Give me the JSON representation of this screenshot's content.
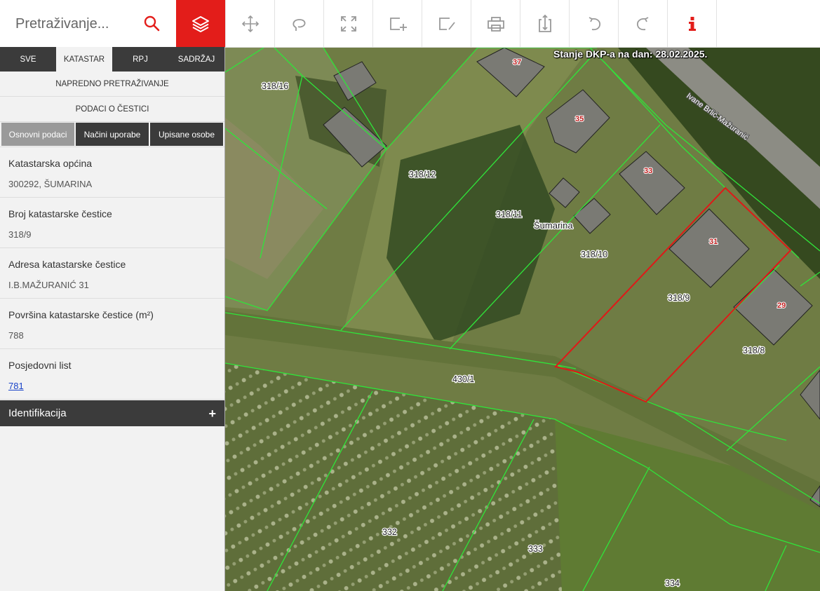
{
  "search": {
    "placeholder": "Pretraživanje..."
  },
  "toolbar": {
    "tools": [
      {
        "name": "layers",
        "icon": "layers-icon"
      },
      {
        "name": "pan",
        "icon": "move-icon"
      },
      {
        "name": "lasso",
        "icon": "lasso-icon"
      },
      {
        "name": "fullscreen",
        "icon": "fullscreen-icon"
      },
      {
        "name": "add-area",
        "icon": "add-area-icon"
      },
      {
        "name": "edit-area",
        "icon": "edit-area-icon"
      },
      {
        "name": "print",
        "icon": "print-icon"
      },
      {
        "name": "export",
        "icon": "export-icon"
      },
      {
        "name": "undo",
        "icon": "undo-icon"
      },
      {
        "name": "redo",
        "icon": "redo-icon"
      },
      {
        "name": "info",
        "icon": "info-icon"
      }
    ],
    "accent_color": "#e31d1a"
  },
  "panel": {
    "top_tabs": [
      "SVE",
      "KATASTAR",
      "RPJ",
      "SADRŽAJ"
    ],
    "advanced_search": "NAPREDNO PRETRAŽIVANJE",
    "parcel_info": "PODACI O ČESTICI",
    "sub_tabs": [
      "Osnovni podaci",
      "Načini uporabe",
      "Upisane osobe"
    ],
    "fields": [
      {
        "label": "Katastarska općina",
        "value": "300292, ŠUMARINA"
      },
      {
        "label": "Broj katastarske čestice",
        "value": "318/9"
      },
      {
        "label": "Adresa katastarske čestice",
        "value": "I.B.MAŽURANIĆ 31"
      },
      {
        "label": "Površina katastarske čestice (m²)",
        "value": "788"
      },
      {
        "label": "Posjedovni list",
        "value": "781"
      }
    ],
    "identification": "Identifikacija"
  },
  "map": {
    "status": "Stanje DKP-a na dan: 28.02.2025.",
    "place_name": "Šumarina",
    "street_name": "Ivane Brlić-Mažuranić",
    "parcels": [
      "318/16",
      "318/12",
      "318/11",
      "318/10",
      "318/9",
      "318/8",
      "430/1",
      "332",
      "333",
      "334"
    ],
    "house_numbers": [
      "37",
      "35",
      "33",
      "31",
      "29"
    ],
    "parcel_line_color": "#2fe53a",
    "selected_parcel_color": "#e01818"
  }
}
